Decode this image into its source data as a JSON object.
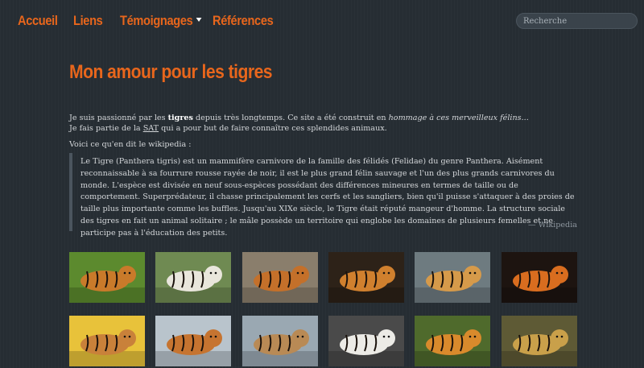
{
  "nav": {
    "items": [
      {
        "label": "Accueil"
      },
      {
        "label": "Liens"
      },
      {
        "label": "Témoignages",
        "has_dropdown": true
      },
      {
        "label": "Références"
      }
    ],
    "search_placeholder": "Recherche"
  },
  "page": {
    "title": "Mon amour pour les tigres",
    "intro": {
      "line1_pre": "Je suis passionné par les ",
      "line1_bold": "tigres",
      "line1_mid": " depuis très longtemps. Ce site a été construit en ",
      "line1_italic": "hommage à ces merveilleux félins...",
      "line2_pre": "Je fais partie de la ",
      "line2_link": "SAT",
      "line2_post": " qui a pour but de faire connaître ces splendides animaux."
    },
    "wiki_intro": "Voici ce qu'en dit le wikipedia :",
    "quote": {
      "text": "Le Tigre (Panthera tigris) est un mammifère carnivore de la famille des félidés (Felidae) du genre Panthera. Aisément reconnaissable à sa fourrure rousse rayée de noir, il est le plus grand félin sauvage et l'un des plus grands carnivores du monde. L'espèce est divisée en neuf sous-espèces possédant des différences mineures en termes de taille ou de comportement. Superprédateur, il chasse principalement les cerfs et les sangliers, bien qu'il puisse s'attaquer à des proies de taille plus importante comme les buffles. Jusqu'au XIXe siècle, le Tigre était réputé mangeur d'homme. La structure sociale des tigres en fait un animal solitaire ; le mâle possède un territoire qui englobe les domaines de plusieurs femelles et ne participe pas à l'éducation des petits.",
      "source": "— Wikipedia"
    }
  },
  "gallery": [
    {
      "name": "tiger-lying-grass-photo",
      "bg": "#5c8a2e",
      "fg": "#c97a2a"
    },
    {
      "name": "white-tiger-walking-photo",
      "bg": "#6f8a52",
      "fg": "#e9e6dc"
    },
    {
      "name": "tiger-standing-snow-photo",
      "bg": "#8a7e6c",
      "fg": "#c4702a"
    },
    {
      "name": "tiger-portrait-dark-photo",
      "bg": "#2d2218",
      "fg": "#d0802e"
    },
    {
      "name": "tiger-rocks-photo",
      "bg": "#6e7b80",
      "fg": "#d69a4a"
    },
    {
      "name": "tiger-face-closeup-photo",
      "bg": "#1d1410",
      "fg": "#d96d1f"
    },
    {
      "name": "tiger-cub-yellow-photo",
      "bg": "#e8c23a",
      "fg": "#c9813a"
    },
    {
      "name": "tiger-running-snow-photo",
      "bg": "#b9c4cc",
      "fg": "#c67430"
    },
    {
      "name": "tiger-snow-walking-photo",
      "bg": "#9aa8b2",
      "fg": "#b98a55"
    },
    {
      "name": "white-tiger-face-photo",
      "bg": "#4a4a4a",
      "fg": "#ecebe6"
    },
    {
      "name": "tiger-roaring-photo",
      "bg": "#4f6a2c",
      "fg": "#d98a2c"
    },
    {
      "name": "leopard-lying-photo",
      "bg": "#5e5a35",
      "fg": "#c9a04a"
    }
  ]
}
